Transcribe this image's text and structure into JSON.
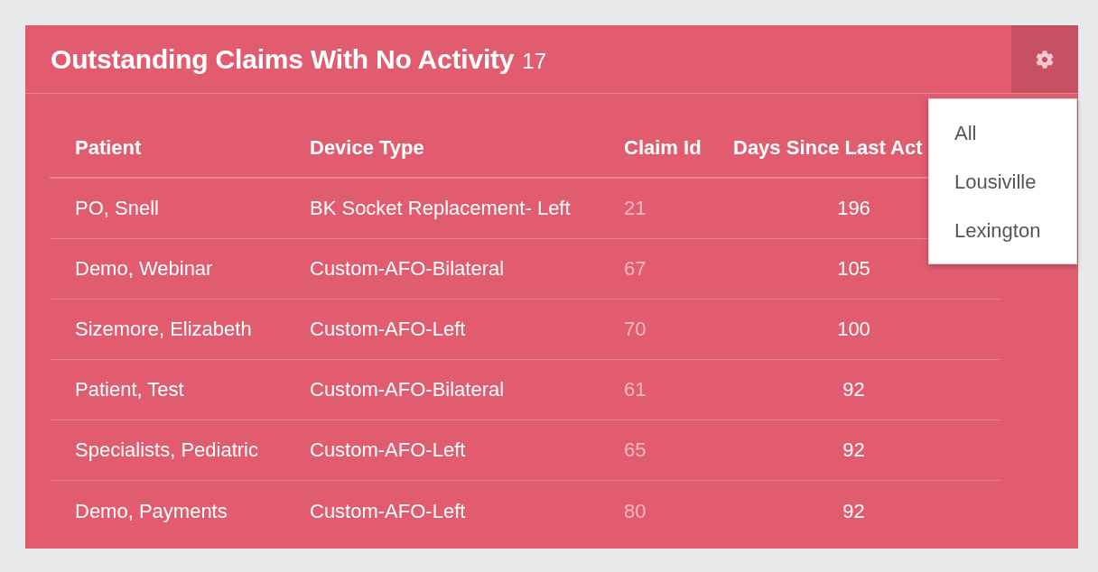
{
  "widget": {
    "title": "Outstanding Claims With No Activity",
    "count": "17"
  },
  "settings_menu": {
    "expanded": true,
    "items": [
      {
        "label": "All"
      },
      {
        "label": "Lousiville"
      },
      {
        "label": "Lexington"
      }
    ]
  },
  "table": {
    "columns": [
      "Patient",
      "Device Type",
      "Claim Id",
      "Days Since Last Act"
    ],
    "rows": [
      [
        "PO, Snell",
        "BK Socket Replacement- Left",
        "21",
        "196"
      ],
      [
        "Demo, Webinar",
        "Custom-AFO-Bilateral",
        "67",
        "105"
      ],
      [
        "Sizemore, Elizabeth",
        "Custom-AFO-Left",
        "70",
        "100"
      ],
      [
        "Patient, Test",
        "Custom-AFO-Bilateral",
        "61",
        "92"
      ],
      [
        "Specialists, Pediatric",
        "Custom-AFO-Left",
        "65",
        "92"
      ],
      [
        "Demo, Payments",
        "Custom-AFO-Left",
        "80",
        "92"
      ]
    ]
  }
}
